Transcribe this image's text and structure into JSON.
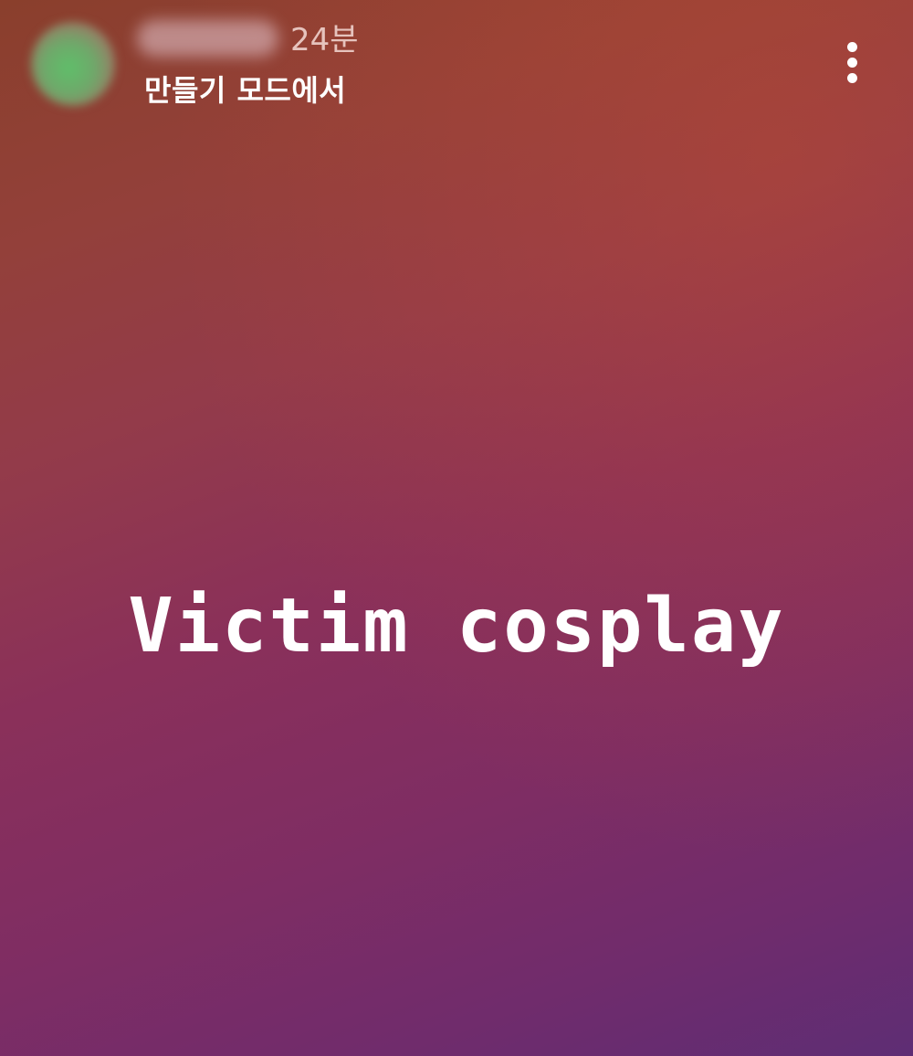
{
  "header": {
    "username": "username",
    "time": "24분",
    "subtitle": "만들기 모드에서"
  },
  "icons": {
    "avatar": "profile-avatar",
    "more": "more-vertical-icon"
  },
  "story": {
    "caption": "Victim cosplay"
  },
  "colors": {
    "gradient_top": "#8a3f2c",
    "gradient_middle": "#8a305a",
    "gradient_bottom": "#5e2d74",
    "text": "#ffffff",
    "time_text": "#e6c3bd"
  }
}
